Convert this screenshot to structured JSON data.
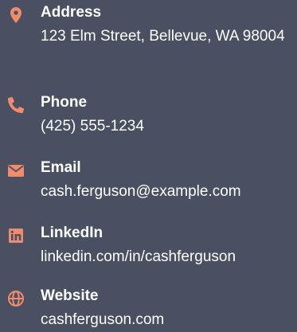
{
  "accent_color": "#f08c6c",
  "contacts": [
    {
      "icon": "location-pin-icon",
      "label": "Address",
      "value": "123 Elm Street, Bellevue, WA 98004"
    },
    {
      "icon": "phone-icon",
      "label": "Phone",
      "value": "(425) 555-1234"
    },
    {
      "icon": "envelope-icon",
      "label": "Email",
      "value": "cash.ferguson@example.com"
    },
    {
      "icon": "linkedin-icon",
      "label": "LinkedIn",
      "value": "linkedin.com/in/cashferguson"
    },
    {
      "icon": "globe-icon",
      "label": "Website",
      "value": "cashferguson.com"
    }
  ]
}
